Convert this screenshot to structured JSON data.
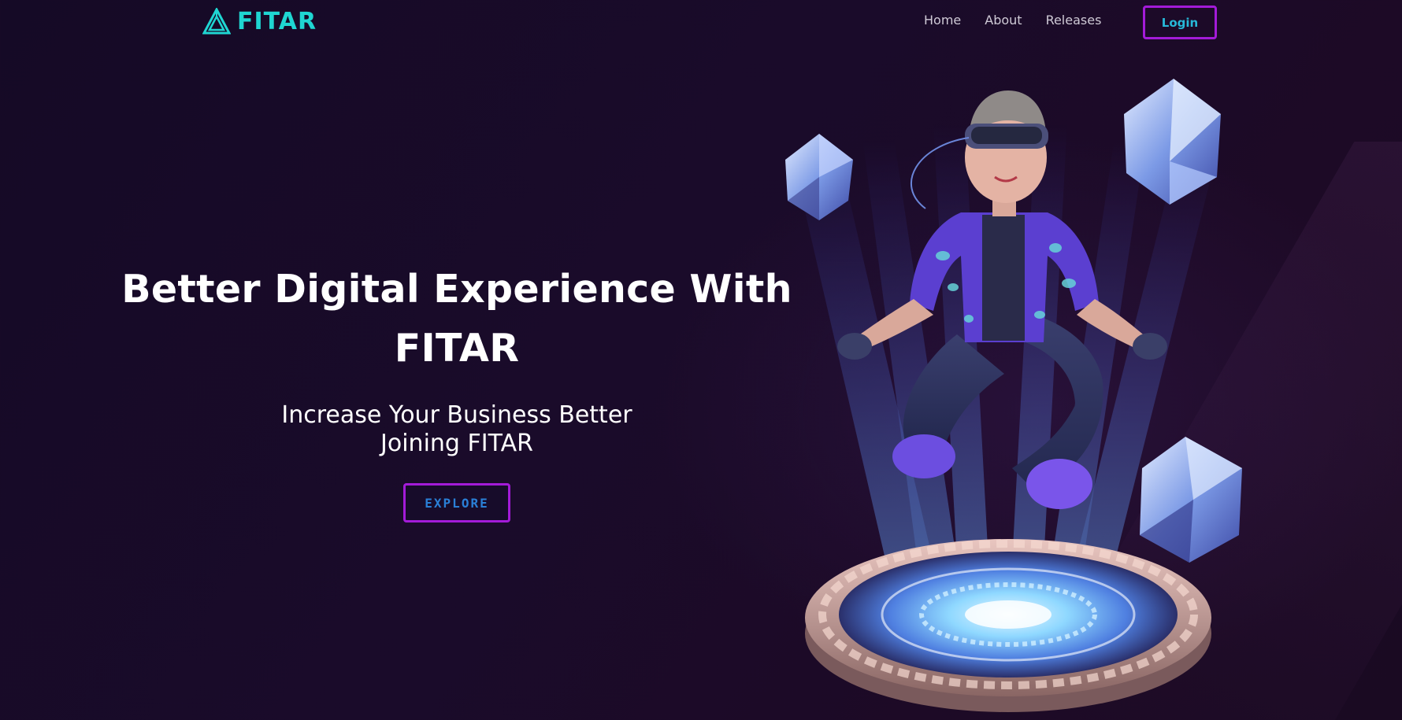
{
  "brand": {
    "name": "FITAR",
    "accent_color": "#1fd6d2",
    "button_border_color": "#a31bd8",
    "button_text_color": "#27b8d8"
  },
  "nav": {
    "links": [
      {
        "label": "Home"
      },
      {
        "label": "About"
      },
      {
        "label": "Releases"
      }
    ],
    "login_label": "Login"
  },
  "hero": {
    "title_line1": "Better Digital Experience With",
    "title_line2": "FITAR",
    "subtitle_line1": "Increase Your Business Better",
    "subtitle_line2": "Joining FITAR",
    "cta_label": "EXPLORE"
  },
  "illustration": {
    "icon": "vr-avatar-floating-on-glowing-platform",
    "crystals": [
      "crystal-left",
      "crystal-top-right",
      "crystal-bottom-right"
    ]
  }
}
